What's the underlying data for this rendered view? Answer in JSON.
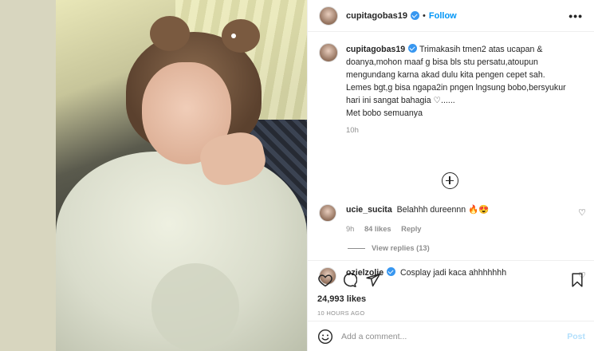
{
  "header": {
    "username": "cupitagobas19",
    "separator": "•",
    "follow_label": "Follow",
    "more_icon": "ellipsis-icon"
  },
  "caption": {
    "username": "cupitagobas19",
    "text": "Trimakasih tmen2 atas ucapan & doanya,mohon maaf g bisa bls stu persatu,atoupun mengundang karna akad dulu kita pengen cepet sah.",
    "line2": "Lemes bgt,g bisa ngapa2in pngen lngsung bobo,bersyukur hari ini sangat bahagia ♡......",
    "line3": "Met bobo semuanya",
    "age": "10h"
  },
  "comments": [
    {
      "username": "ucie_sucita",
      "text": "Belahhh dureennn 🔥😍",
      "age": "9h",
      "likes": "84 likes",
      "reply": "Reply",
      "view_replies": "View replies (13)"
    },
    {
      "username": "ozielzolie",
      "text": "Cosplay jadi kaca ahhhhhhh"
    }
  ],
  "post_stats": {
    "likes": "24,993 likes",
    "time": "10 HOURS AGO"
  },
  "composer": {
    "placeholder": "Add a comment...",
    "post_label": "Post"
  },
  "colors": {
    "accent": "#0095f6",
    "verified": "#3897f0",
    "muted": "#8e8e8e",
    "post_disabled": "#b2dffc"
  }
}
